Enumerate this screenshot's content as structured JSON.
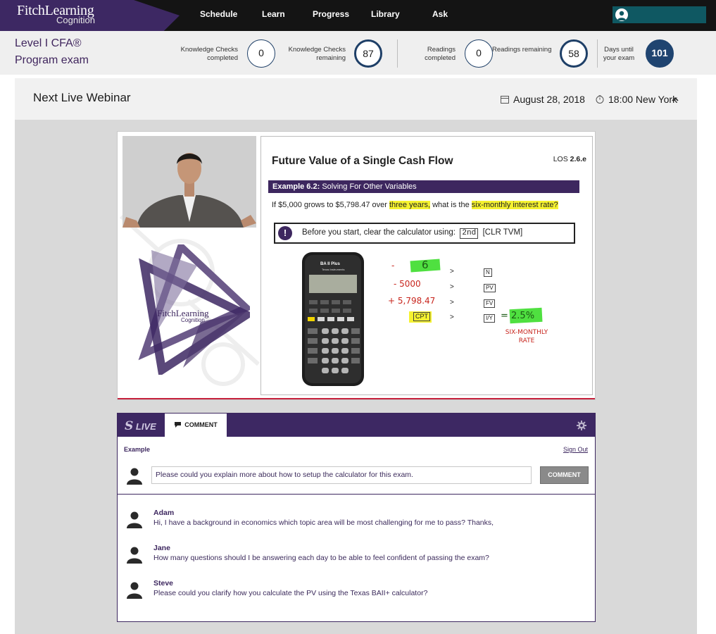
{
  "brand": {
    "name": "FitchLearning",
    "sub": "Cognition"
  },
  "nav": {
    "items": [
      "Schedule",
      "Learn",
      "Progress",
      "Library",
      "Ask"
    ]
  },
  "exam": {
    "line1": "Level I CFA®",
    "line2": "Program exam"
  },
  "stats": [
    {
      "label_1": "Knowledge Checks",
      "label_2": "completed",
      "value": "0"
    },
    {
      "label_1": "Knowledge Checks",
      "label_2": "remaining",
      "value": "87"
    },
    {
      "label_1": "Readings",
      "label_2": "completed",
      "value": "0"
    },
    {
      "label_1": "Readings remaining",
      "label_2": "",
      "value": "58"
    },
    {
      "label_1": "Days until",
      "label_2": "your exam",
      "value": "101"
    }
  ],
  "webinar": {
    "title": "Next Live Webinar",
    "date": "August 28, 2018",
    "time": "18:00 New York"
  },
  "slide": {
    "title": "Future Value of a Single Cash Flow",
    "los_prefix": "LOS",
    "los_value": "2.6.e",
    "example_bold": "Example 6.2:",
    "example_text": "Solving For Other Variables",
    "question_a": "If $5,000 grows to $5,798.47 over ",
    "question_hl1": "three years,",
    "question_b": " what is the ",
    "question_hl2": "six-monthly interest rate?",
    "callout_text": "Before you start, clear the calculator using:",
    "callout_key1": "2nd",
    "callout_key2": "[CLR TVM]",
    "calc_brand": "BA II Plus",
    "calc_maker": "Texas Instruments",
    "hand_1": "6",
    "hand_2": "- 5000",
    "hand_3": "+ 5,798.47",
    "hand_cpt": "CPT",
    "hand_result": "= 2.5%",
    "hand_note": "SIX-MONTHLY RATE",
    "keys": [
      "N",
      "PV",
      "FV",
      "I/Y"
    ],
    "arrow": ">",
    "logo_name": "FitchLearning",
    "logo_sub": "Cognition"
  },
  "comments": {
    "tab_live": "LIVE",
    "tab_comment": "COMMENT",
    "context_label": "Example",
    "signout": "Sign Out",
    "input_value": "Please could you explain more about how to setup the calculator for this exam.",
    "button": "COMMENT",
    "items": [
      {
        "name": "Adam",
        "text": "Hi, I have a background in economics which topic area will be most challenging for me to pass? Thanks,"
      },
      {
        "name": "Jane",
        "text": "How many questions should I be answering each day to be able to feel confident of passing the exam?"
      },
      {
        "name": "Steve",
        "text": "Please could you clarify how you calculate the PV using the Texas BAII+ calculator?"
      }
    ]
  },
  "colors": {
    "brand_purple": "#3d275f",
    "nav_bg": "#141414",
    "account_teal": "#0f5862",
    "days_blue": "#1f4470",
    "accent_red": "#c6213c"
  }
}
